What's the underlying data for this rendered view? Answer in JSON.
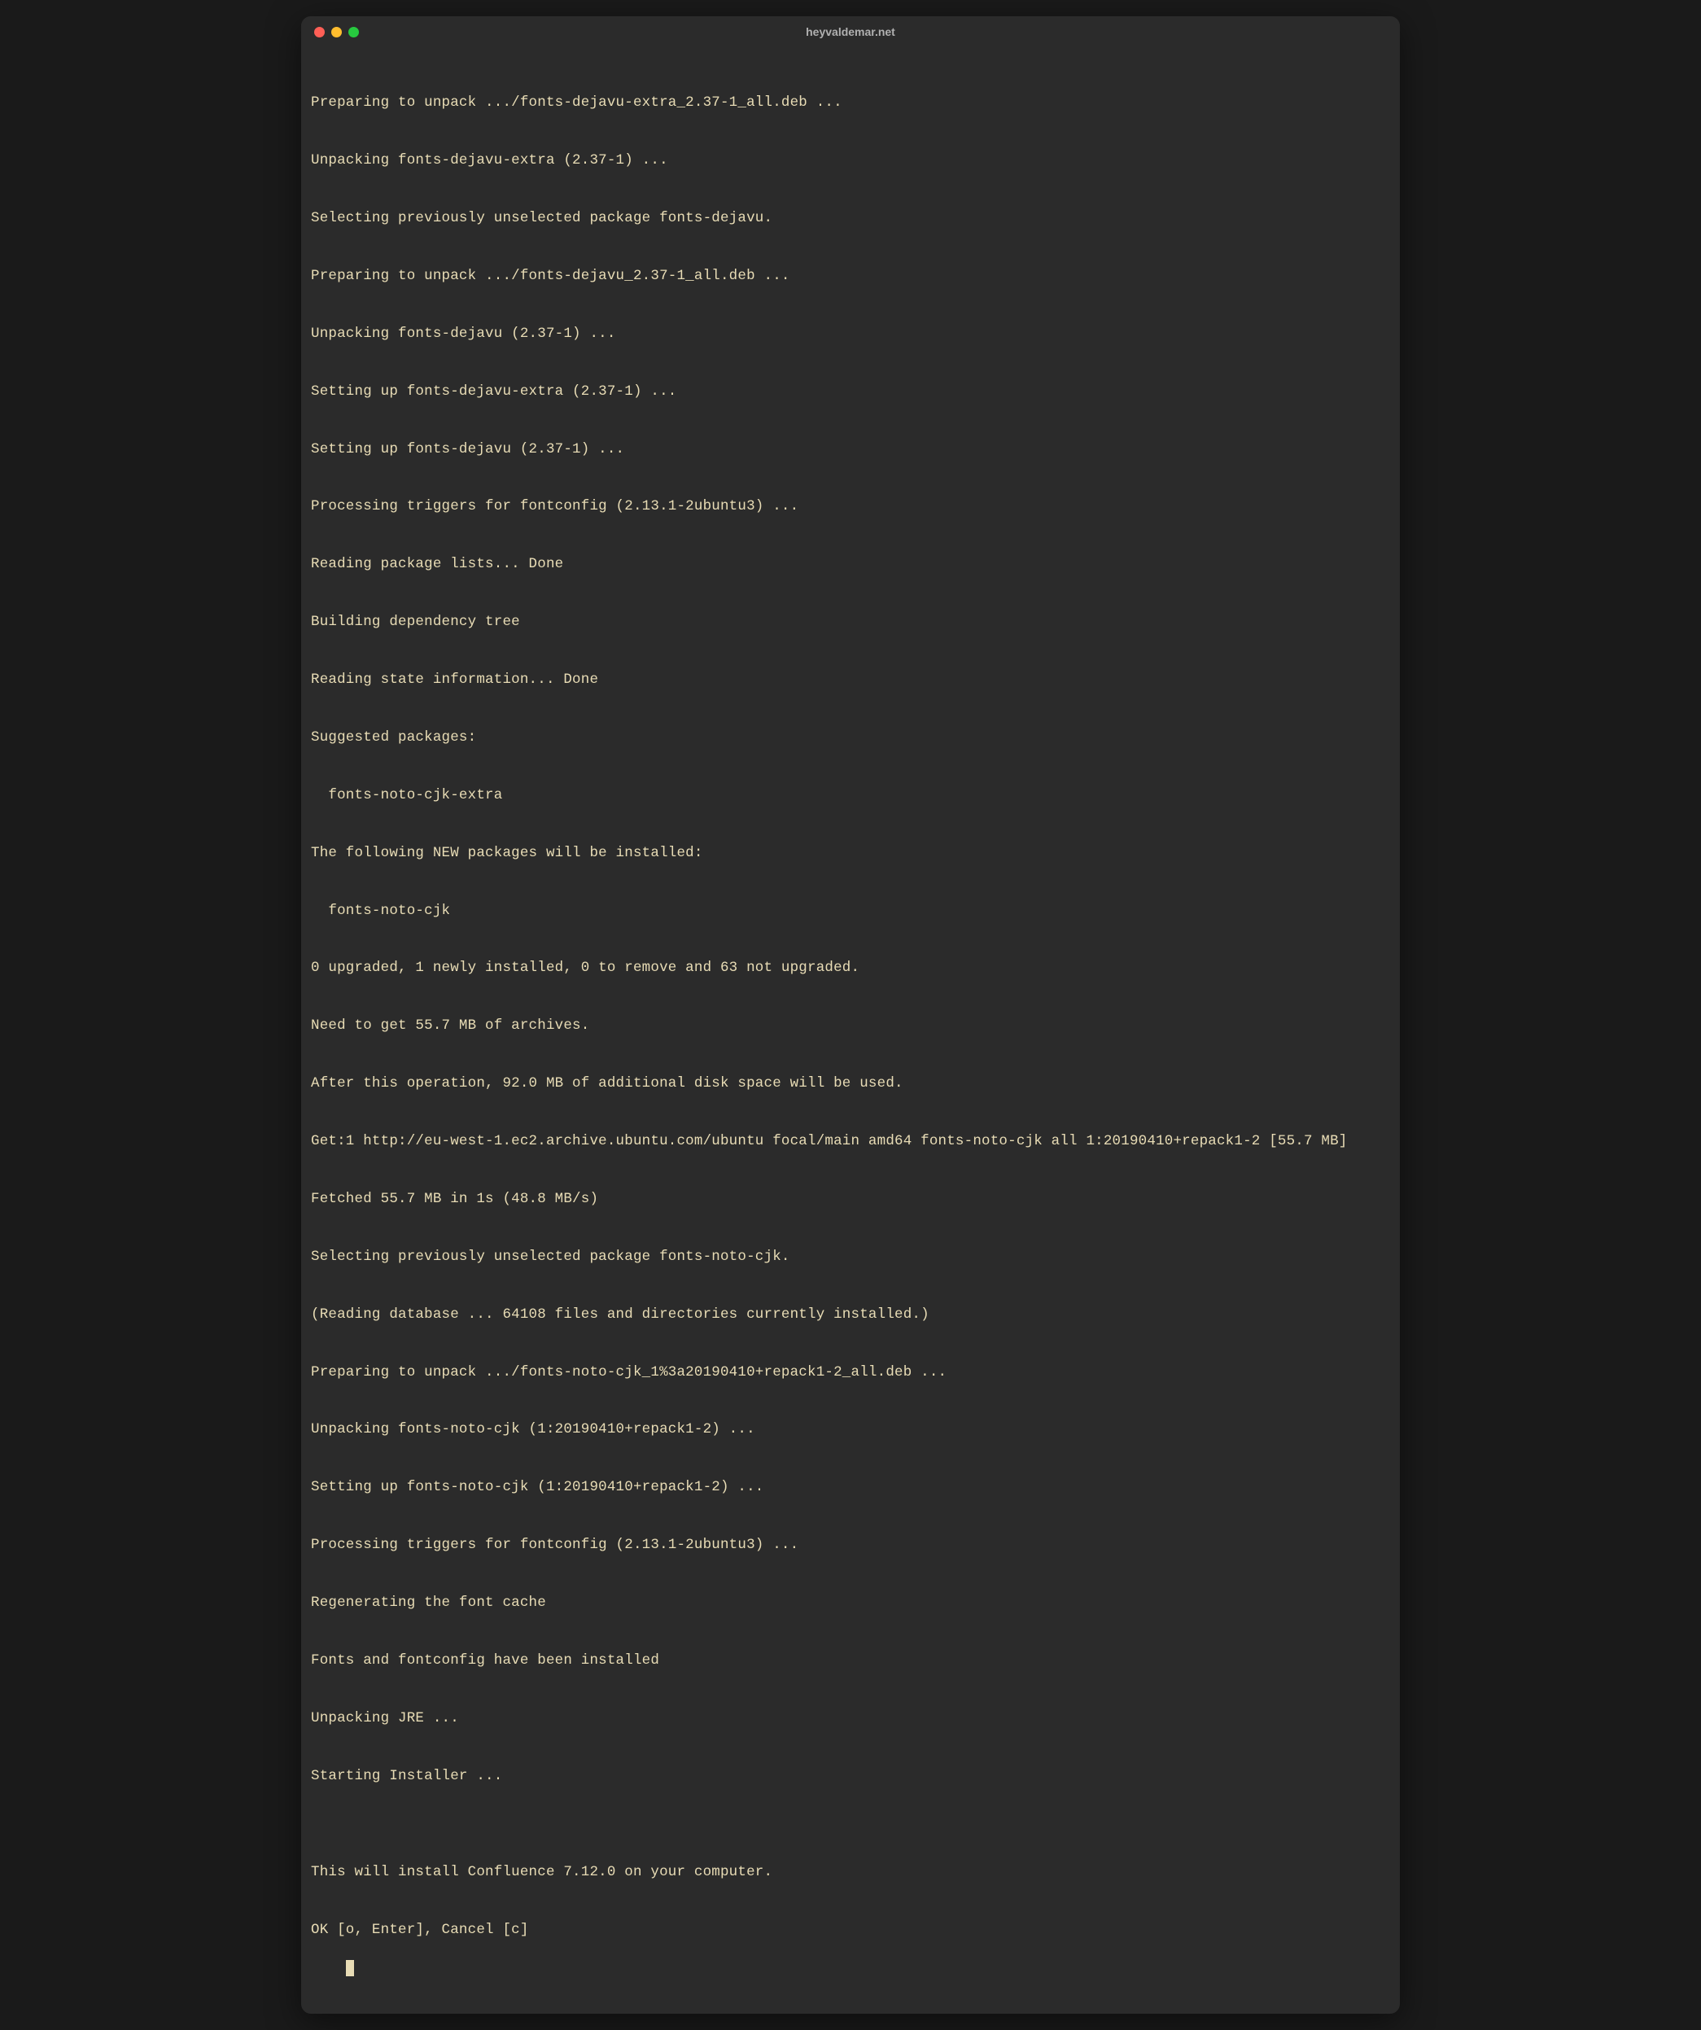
{
  "window": {
    "title": "heyvaldemar.net"
  },
  "terminal": {
    "lines": [
      "Preparing to unpack .../fonts-dejavu-extra_2.37-1_all.deb ...",
      "Unpacking fonts-dejavu-extra (2.37-1) ...",
      "Selecting previously unselected package fonts-dejavu.",
      "Preparing to unpack .../fonts-dejavu_2.37-1_all.deb ...",
      "Unpacking fonts-dejavu (2.37-1) ...",
      "Setting up fonts-dejavu-extra (2.37-1) ...",
      "Setting up fonts-dejavu (2.37-1) ...",
      "Processing triggers for fontconfig (2.13.1-2ubuntu3) ...",
      "Reading package lists... Done",
      "Building dependency tree",
      "Reading state information... Done",
      "Suggested packages:",
      "  fonts-noto-cjk-extra",
      "The following NEW packages will be installed:",
      "  fonts-noto-cjk",
      "0 upgraded, 1 newly installed, 0 to remove and 63 not upgraded.",
      "Need to get 55.7 MB of archives.",
      "After this operation, 92.0 MB of additional disk space will be used.",
      "Get:1 http://eu-west-1.ec2.archive.ubuntu.com/ubuntu focal/main amd64 fonts-noto-cjk all 1:20190410+repack1-2 [55.7 MB]",
      "Fetched 55.7 MB in 1s (48.8 MB/s)",
      "Selecting previously unselected package fonts-noto-cjk.",
      "(Reading database ... 64108 files and directories currently installed.)",
      "Preparing to unpack .../fonts-noto-cjk_1%3a20190410+repack1-2_all.deb ...",
      "Unpacking fonts-noto-cjk (1:20190410+repack1-2) ...",
      "Setting up fonts-noto-cjk (1:20190410+repack1-2) ...",
      "Processing triggers for fontconfig (2.13.1-2ubuntu3) ...",
      "Regenerating the font cache",
      "Fonts and fontconfig have been installed",
      "Unpacking JRE ...",
      "Starting Installer ...",
      "",
      "This will install Confluence 7.12.0 on your computer.",
      "OK [o, Enter], Cancel [c]"
    ]
  }
}
